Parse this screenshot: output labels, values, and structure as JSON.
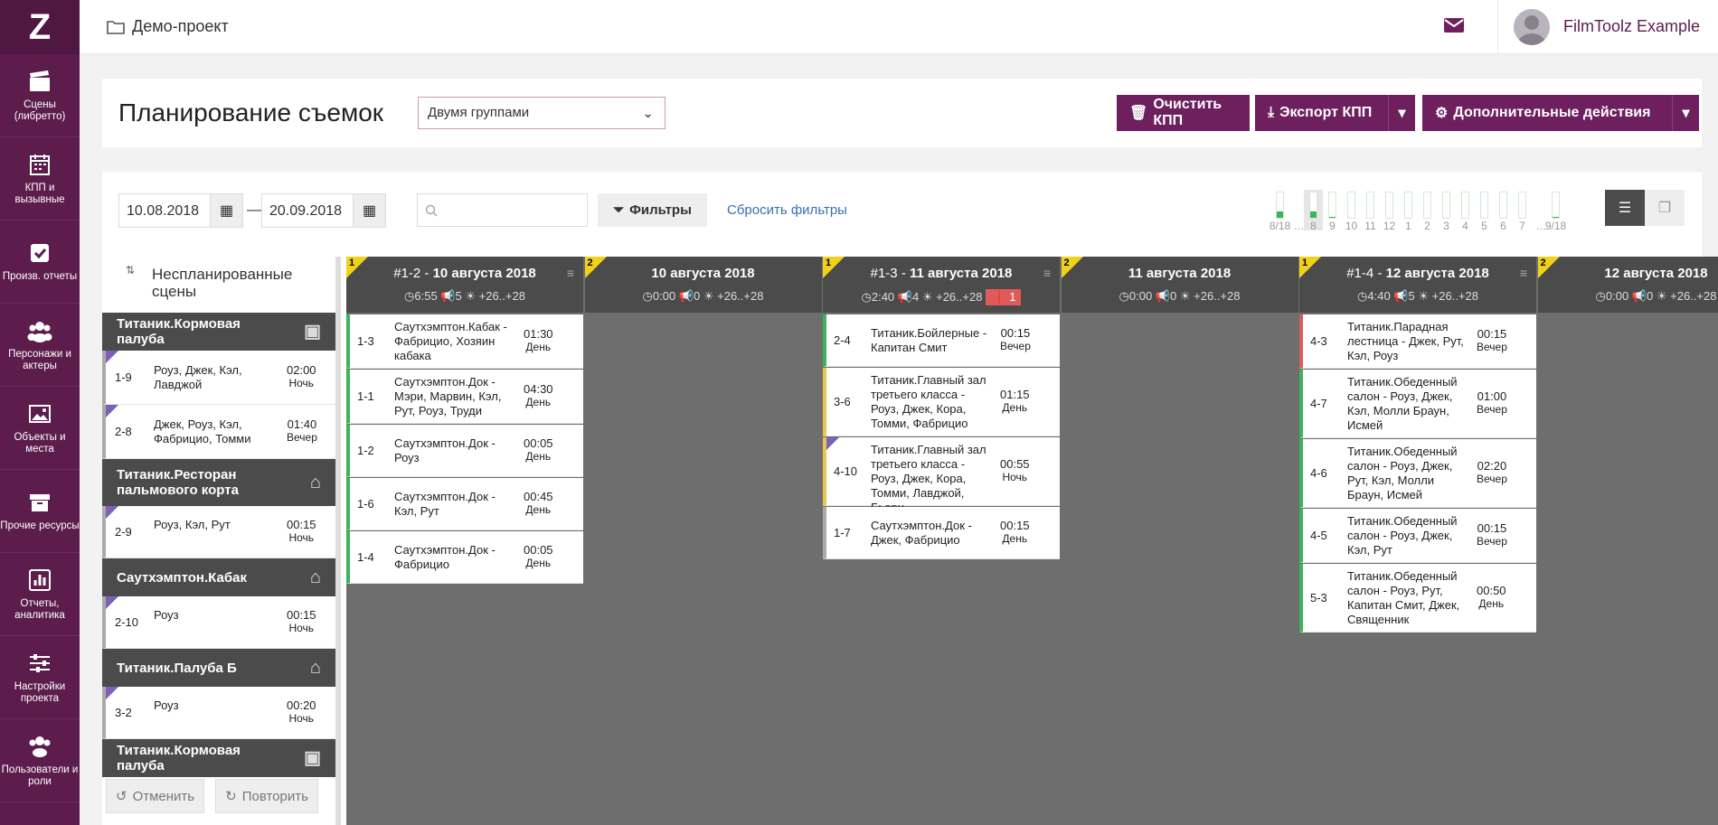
{
  "app": {
    "logo": "Z"
  },
  "sidebar": {
    "items": [
      {
        "label": "Сцены (либретто)",
        "icon": "clapper-icon"
      },
      {
        "label": "КПП и вызывные",
        "icon": "calendar-icon"
      },
      {
        "label": "Произв. отчеты",
        "icon": "checkbox-icon"
      },
      {
        "label": "Персонажи и актеры",
        "icon": "people-icon"
      },
      {
        "label": "Объекты и места",
        "icon": "image-icon"
      },
      {
        "label": "Прочие ресурсы",
        "icon": "archive-icon"
      },
      {
        "label": "Отчеты, аналитика",
        "icon": "chart-icon"
      },
      {
        "label": "Настройки проекта",
        "icon": "sliders-icon"
      },
      {
        "label": "Пользователи и роли",
        "icon": "users-icon"
      }
    ]
  },
  "header": {
    "project": "Демо-проект",
    "user": "FilmToolz Example"
  },
  "toolbar": {
    "title": "Планирование съемок",
    "mode": "Двумя группами",
    "clear": "Очистить КПП",
    "export": "Экспорт КПП",
    "more": "Дополнительные действия"
  },
  "filters": {
    "date_from": "10.08.2018",
    "dash": "—",
    "date_to": "20.09.2018",
    "search_placeholder": "",
    "filters_btn": "Фильтры",
    "reset": "Сбросить фильтры"
  },
  "day_bars": [
    {
      "label": "8/18",
      "level": 0.25
    },
    {
      "label": "…",
      "level": 0
    },
    {
      "label": "8",
      "level": 0.25
    },
    {
      "label": "9",
      "level": 0.04
    },
    {
      "label": "10",
      "level": 0
    },
    {
      "label": "11",
      "level": 0
    },
    {
      "label": "12",
      "level": 0
    },
    {
      "label": "1",
      "level": 0
    },
    {
      "label": "2",
      "level": 0
    },
    {
      "label": "3",
      "level": 0
    },
    {
      "label": "4",
      "level": 0
    },
    {
      "label": "5",
      "level": 0
    },
    {
      "label": "6",
      "level": 0
    },
    {
      "label": "7",
      "level": 0
    },
    {
      "label": "…",
      "level": 0
    },
    {
      "label": "9/18",
      "level": 0.04
    }
  ],
  "unplanned": {
    "title": "Неспланированные сцены",
    "groups": [
      {
        "name": "Титаник.Кормовая палуба",
        "icon": "image-icon",
        "rows": [
          {
            "num": "1-9",
            "desc": "Роуз, Джек, Кэл, Лавджой",
            "time": "02:00",
            "part": "Ночь"
          },
          {
            "num": "2-8",
            "desc": "Джек, Роуз, Кэл, Фабрицио, Томми",
            "time": "01:40",
            "part": "Вечер"
          }
        ]
      },
      {
        "name": "Титаник.Ресторан пальмового корта",
        "icon": "home-icon",
        "rows": [
          {
            "num": "2-9",
            "desc": "Роуз, Кэл, Рут",
            "time": "00:15",
            "part": "Ночь"
          }
        ]
      },
      {
        "name": "Саутхэмптон.Кабак",
        "icon": "home-icon",
        "rows": [
          {
            "num": "2-10",
            "desc": "Роуз",
            "time": "00:15",
            "part": "Ночь"
          }
        ]
      },
      {
        "name": "Титаник.Палуба Б",
        "icon": "home-icon",
        "rows": [
          {
            "num": "3-2",
            "desc": "Роуз",
            "time": "00:20",
            "part": "Ночь"
          }
        ]
      },
      {
        "name": "Титаник.Кормовая палуба",
        "icon": "image-icon",
        "rows": []
      }
    ],
    "undo": "Отменить",
    "redo": "Повторить"
  },
  "columns": [
    {
      "badge": "1",
      "title_prefix": "#1-2 - ",
      "title": "10 августа 2018",
      "time": "6:55",
      "count": "5",
      "temp": "+26..+28",
      "warn": "",
      "cards": [
        {
          "num": "1-3",
          "desc": "Саутхэмптон.Кабак - Фабрицио, Хозяин кабака",
          "time": "01:30",
          "part": "День",
          "color": "#3cb45a"
        },
        {
          "num": "1-1",
          "desc": "Саутхэмптон.Док - Мэри, Марвин, Кэл, Рут, Роуз, Труди",
          "time": "04:30",
          "part": "День",
          "color": "#3cb45a"
        },
        {
          "num": "1-2",
          "desc": "Саутхэмптон.Док - Роуз",
          "time": "00:05",
          "part": "День",
          "color": "#3cb45a"
        },
        {
          "num": "1-6",
          "desc": "Саутхэмптон.Док - Кэл, Рут",
          "time": "00:45",
          "part": "День",
          "color": "#3cb45a"
        },
        {
          "num": "1-4",
          "desc": "Саутхэмптон.Док - Фабрицио",
          "time": "00:05",
          "part": "День",
          "color": "#3cb45a"
        }
      ]
    },
    {
      "badge": "2",
      "title_prefix": "",
      "title": "10 августа 2018",
      "time": "0:00",
      "count": "0",
      "temp": "+26..+28",
      "warn": "",
      "cards": []
    },
    {
      "badge": "1",
      "title_prefix": "#1-3 - ",
      "title": "11 августа 2018",
      "time": "2:40",
      "count": "4",
      "temp": "+26..+28",
      "warn": "1",
      "cards": [
        {
          "num": "2-4",
          "desc": "Титаник.Бойлерные - Капитан Смит",
          "time": "00:15",
          "part": "Вечер",
          "color": "#3cb45a"
        },
        {
          "num": "3-6",
          "desc": "Титаник.Главный зал третьего класса - Роуз, Джек, Кора, Томми, Фабрицио",
          "time": "01:15",
          "part": "День",
          "color": "#e6c84a"
        },
        {
          "num": "4-10",
          "desc": "Титаник.Главный зал третьего класса - Роуз, Джек, Кора, Томми, Лавджой, Бьерн",
          "time": "00:55",
          "part": "Ночь",
          "color": "#e6c84a"
        },
        {
          "num": "1-7",
          "desc": "Саутхэмптон.Док - Джек, Фабрицио",
          "time": "00:15",
          "part": "День",
          "color": "#aaaaaa"
        }
      ]
    },
    {
      "badge": "2",
      "title_prefix": "",
      "title": "11 августа 2018",
      "time": "0:00",
      "count": "0",
      "temp": "+26..+28",
      "warn": "",
      "cards": []
    },
    {
      "badge": "1",
      "title_prefix": "#1-4 - ",
      "title": "12 августа 2018",
      "time": "4:40",
      "count": "5",
      "temp": "+26..+28",
      "warn": "",
      "cards": [
        {
          "num": "4-3",
          "desc": "Титаник.Парадная лестница - Джек, Рут, Кэл, Роуз",
          "time": "00:15",
          "part": "Вечер",
          "color": "#e05a5a"
        },
        {
          "num": "4-7",
          "desc": "Титаник.Обеденный салон - Роуз, Джек, Кэл, Молли Браун, Исмей",
          "time": "01:00",
          "part": "Вечер",
          "color": "#3cb45a"
        },
        {
          "num": "4-6",
          "desc": "Титаник.Обеденный салон - Роуз, Джек, Рут, Кэл, Молли Браун, Исмей",
          "time": "02:20",
          "part": "Вечер",
          "color": "#3cb45a"
        },
        {
          "num": "4-5",
          "desc": "Титаник.Обеденный салон - Роуз, Джек, Кэл, Рут",
          "time": "00:15",
          "part": "Вечер",
          "color": "#3cb45a"
        },
        {
          "num": "5-3",
          "desc": "Титаник.Обеденный салон - Роуз, Рут, Капитан Смит, Джек, Священник",
          "time": "00:50",
          "part": "День",
          "color": "#3cb45a"
        }
      ]
    },
    {
      "badge": "2",
      "title_prefix": "",
      "title": "12 августа 2018",
      "time": "0:00",
      "count": "0",
      "temp": "+26..+28",
      "warn": "",
      "cards": []
    }
  ]
}
